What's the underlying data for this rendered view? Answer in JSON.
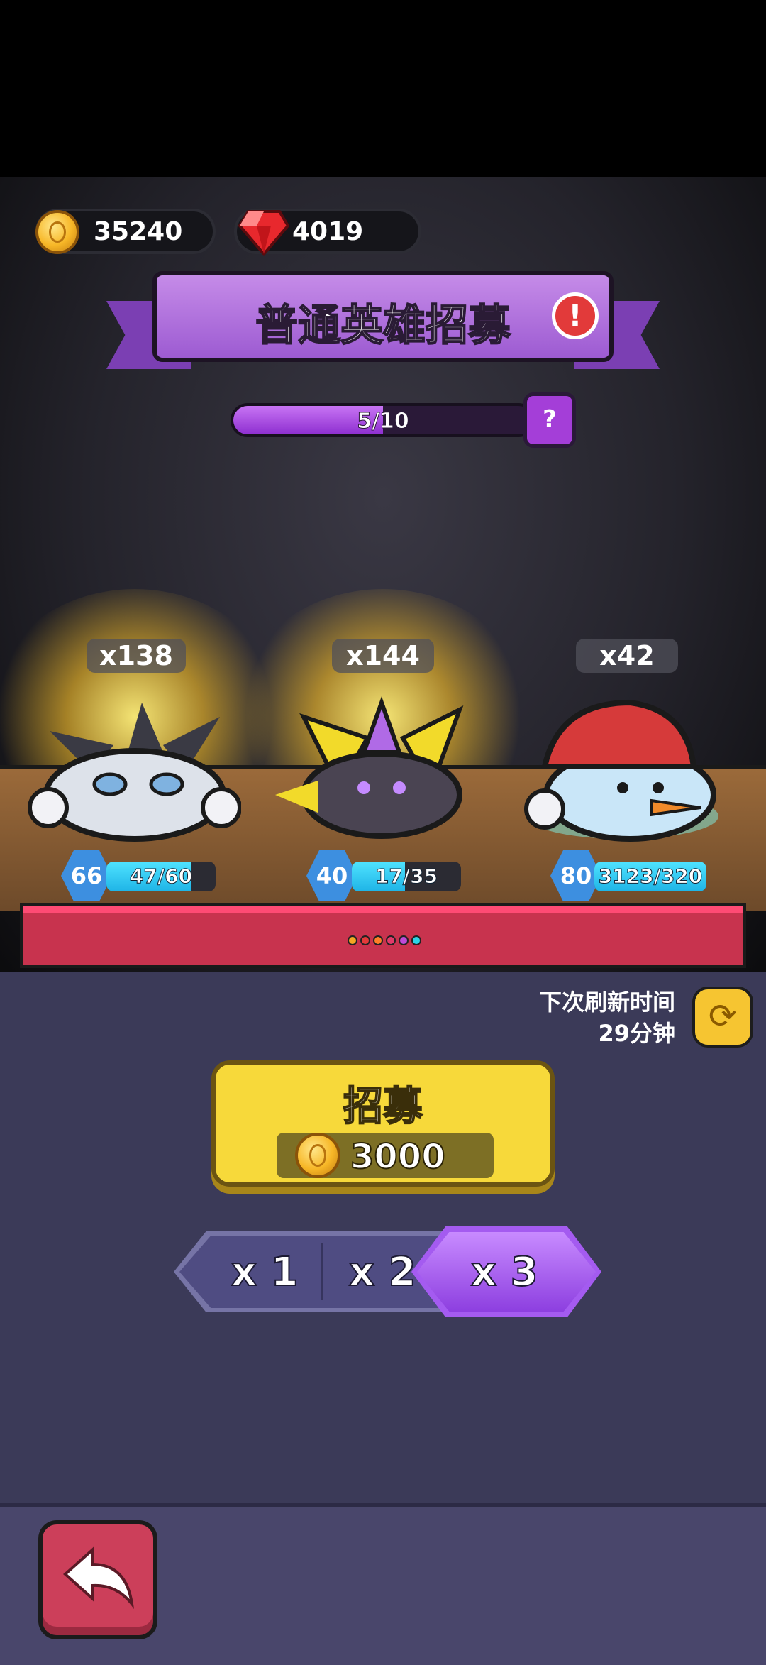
{
  "currency": {
    "gold": "35240",
    "gems": "4019"
  },
  "banner": {
    "title": "普通英雄招募",
    "alert_symbol": "!"
  },
  "progress": {
    "text": "5/10",
    "fraction": 0.5,
    "help_symbol": "?"
  },
  "heroes": [
    {
      "name_icon": "spiky-rock-creature-icon",
      "count": "x138",
      "level": "66",
      "shards": "47/60",
      "shard_fraction": 0.78
    },
    {
      "name_icon": "purple-armored-beast-icon",
      "count": "x144",
      "level": "40",
      "shards": "17/35",
      "shard_fraction": 0.49
    },
    {
      "name_icon": "snowman-hat-icon",
      "count": "x42",
      "level": "80",
      "shards": "3123/320",
      "shard_fraction": 1.0
    }
  ],
  "refresh": {
    "label": "下次刷新时间",
    "time": "29分钟"
  },
  "recruit": {
    "label": "招募",
    "cost": "3000"
  },
  "multiplier": {
    "options": [
      "x 1",
      "x 2",
      "x 3"
    ],
    "selected": "x 3"
  },
  "colors": {
    "accent_purple": "#9d5bd2",
    "gold_button": "#f7d93a",
    "back_button": "#cc3f5a",
    "shard_cyan": "#1fb4e6"
  }
}
